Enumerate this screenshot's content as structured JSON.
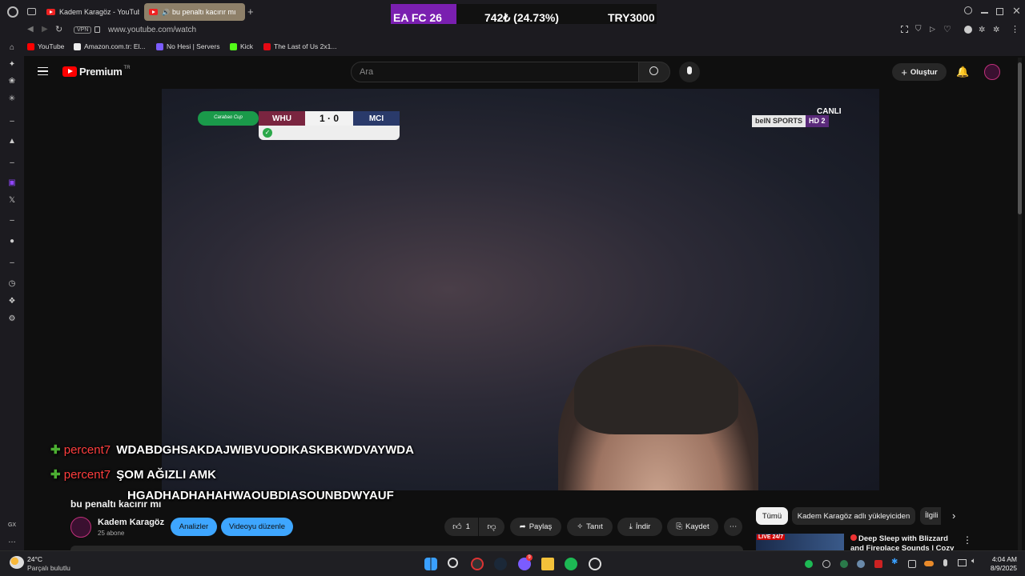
{
  "browser": {
    "tabs": [
      {
        "title": "Kadem Karagöz - YouTube"
      },
      {
        "title": "bu penaltı kacırır mı"
      }
    ],
    "url": "www.youtube.com/watch",
    "vpn": "VPN",
    "bookmarks": [
      {
        "label": "YouTube",
        "color": "#ff0000"
      },
      {
        "label": "Amazon.com.tr: El...",
        "color": "#ffffff"
      },
      {
        "label": "No Hesi | Servers",
        "color": "#7b5cff"
      },
      {
        "label": "Kick",
        "color": "#53fc18"
      },
      {
        "label": "The Last of Us 2x1...",
        "color": "#e50914"
      }
    ]
  },
  "ad_banner": {
    "left": "EA FC 26",
    "middle": "742₺ (24.73%)",
    "right": "TRY3000"
  },
  "youtube": {
    "logo_text": "Premium",
    "region": "TR",
    "search_placeholder": "Ara",
    "create_label": "Oluştur"
  },
  "scoreboard": {
    "competition": "Carabao Cup",
    "home": "WHU",
    "score": "1 · 0",
    "away": "MCI",
    "broadcaster": "beIN SPORTS",
    "channel": "HD 2",
    "live_label": "CANLI"
  },
  "chat_overlay": [
    {
      "user": "percent7",
      "message": "WDABDGHSAKDAJWIBVUODIKASKBKWDVAYWDA"
    },
    {
      "user": "percent7",
      "message": "ŞOM AĞIZLI AMK"
    },
    {
      "user": "",
      "message": "HGADHADHAHAHWAOUBDIASOUNBDWYAUF"
    }
  ],
  "video_info": {
    "title": "bu penaltı kacırır mı",
    "channel_name": "Kadem Karagöz",
    "subscribers": "25 abone",
    "analytics_label": "Analizler",
    "edit_label": "Videoyu düzenle",
    "likes": "1",
    "share_label": "Paylaş",
    "promote_label": "Tanıt",
    "download_label": "İndir",
    "save_label": "Kaydet"
  },
  "sidebar_filters": [
    "Tümü",
    "Kadem Karagöz adlı yükleyiciden",
    "İlgili"
  ],
  "recommended": [
    {
      "title": "Deep Sleep with Blizzard and Fireplace Sounds | Cozy",
      "badge": "LIVE 24/7"
    }
  ],
  "taskbar": {
    "temperature": "24°C",
    "weather": "Parçalı bulutlu",
    "time": "4:04 AM",
    "date": "8/9/2025",
    "discord_badge": "9"
  },
  "opera": {
    "gx_label": "GX"
  }
}
